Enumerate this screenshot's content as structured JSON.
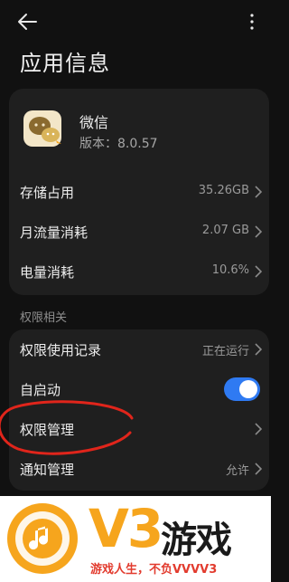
{
  "header": {
    "title": "应用信息",
    "back_icon": "arrow-left-icon",
    "more_icon": "more-vertical-icon"
  },
  "app": {
    "name": "微信",
    "version_line": "版本：8.0.57",
    "icon": "wechat-icon",
    "icon_color": "#f3e6c8"
  },
  "info_rows": [
    {
      "label": "存储占用",
      "value": "35.26GB"
    },
    {
      "label": "月流量消耗",
      "value": "2.07 GB"
    },
    {
      "label": "电量消耗",
      "value": "10.6%"
    }
  ],
  "permissions": {
    "section_title": "权限相关",
    "rows": [
      {
        "label": "权限使用记录",
        "value": "正在运行"
      },
      {
        "label": "自启动",
        "toggle": true
      },
      {
        "label": "权限管理",
        "value": ""
      },
      {
        "label": "通知管理",
        "value": "允许"
      }
    ]
  },
  "annotation": {
    "shape": "ellipse",
    "color": "#e0251b",
    "target": "权限管理"
  },
  "watermark": {
    "logo": "V3",
    "brand": "游戏",
    "slogan": "游戏人生，不负VVVV3",
    "logo_color": "#f6a51d",
    "slogan_color": "#e23b2e"
  },
  "colors": {
    "background": "#111111",
    "card": "#1f1f1f",
    "accent": "#2f7af2"
  }
}
